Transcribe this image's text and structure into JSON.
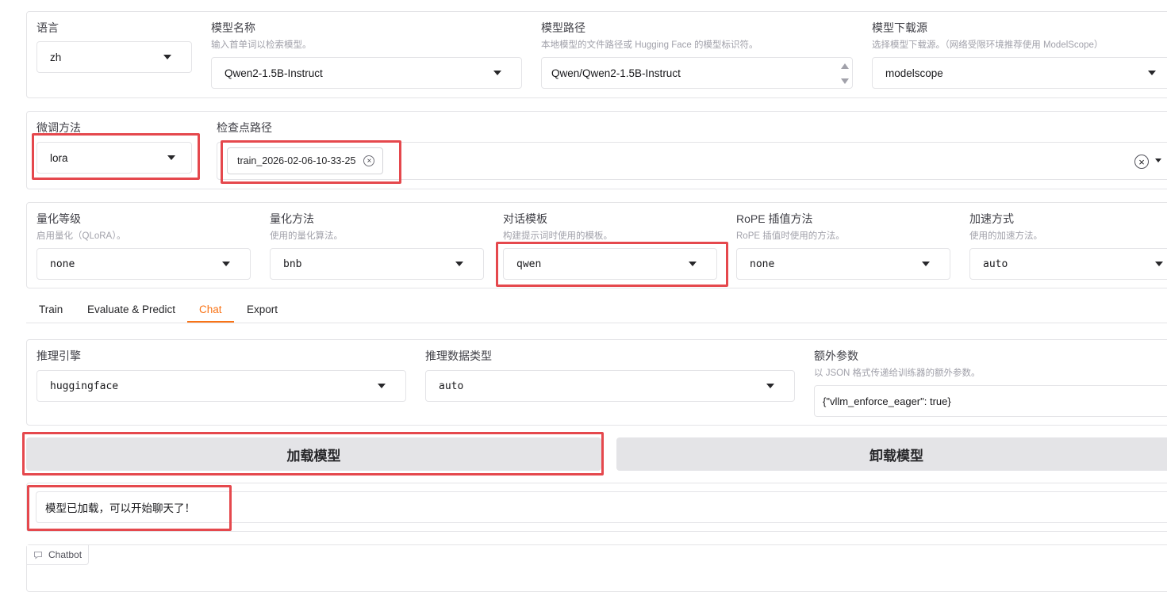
{
  "model_row": {
    "lang": {
      "label": "语言",
      "value": "zh"
    },
    "model_name": {
      "label": "模型名称",
      "hint": "输入首单词以检索模型。",
      "value": "Qwen2-1.5B-Instruct"
    },
    "model_path": {
      "label": "模型路径",
      "hint": "本地模型的文件路径或 Hugging Face 的模型标识符。",
      "value": "Qwen/Qwen2-1.5B-Instruct"
    },
    "hub": {
      "label": "模型下载源",
      "hint": "选择模型下载源。（网络受限环境推荐使用 ModelScope）",
      "value": "modelscope"
    }
  },
  "finetune_row": {
    "method": {
      "label": "微调方法",
      "value": "lora"
    },
    "checkpoint": {
      "label": "检查点路径",
      "chips": [
        "train_2026-02-06-10-33-25"
      ],
      "chip_remove": "×",
      "clear": "×"
    }
  },
  "adv_row": {
    "quant_bit": {
      "label": "量化等级",
      "hint": "启用量化（QLoRA）。",
      "value": "none"
    },
    "quant_method": {
      "label": "量化方法",
      "hint": "使用的量化算法。",
      "value": "bnb"
    },
    "template": {
      "label": "对话模板",
      "hint": "构建提示词时使用的模板。",
      "value": "qwen"
    },
    "rope": {
      "label": "RoPE 插值方法",
      "hint": "RoPE 插值时使用的方法。",
      "value": "none"
    },
    "booster": {
      "label": "加速方式",
      "hint": "使用的加速方法。",
      "value": "auto"
    }
  },
  "tabs": [
    {
      "label": "Train",
      "active": false
    },
    {
      "label": "Evaluate & Predict",
      "active": false
    },
    {
      "label": "Chat",
      "active": true
    },
    {
      "label": "Export",
      "active": false
    }
  ],
  "infer_row": {
    "backend": {
      "label": "推理引擎",
      "value": "huggingface"
    },
    "dtype": {
      "label": "推理数据类型",
      "value": "auto"
    },
    "extra": {
      "label": "额外参数",
      "hint": "以 JSON 格式传递给训练器的额外参数。",
      "value": "{\"vllm_enforce_eager\": true}"
    }
  },
  "buttons": {
    "load": "加载模型",
    "unload": "卸载模型"
  },
  "status": {
    "text": "模型已加载，可以开始聊天了！"
  },
  "chatbot": {
    "label": "Chatbot",
    "icon": "chat-bubble-icon"
  },
  "colors": {
    "accent": "#f97316",
    "highlight": "#e5484d",
    "button_bg": "#e4e4e7"
  }
}
